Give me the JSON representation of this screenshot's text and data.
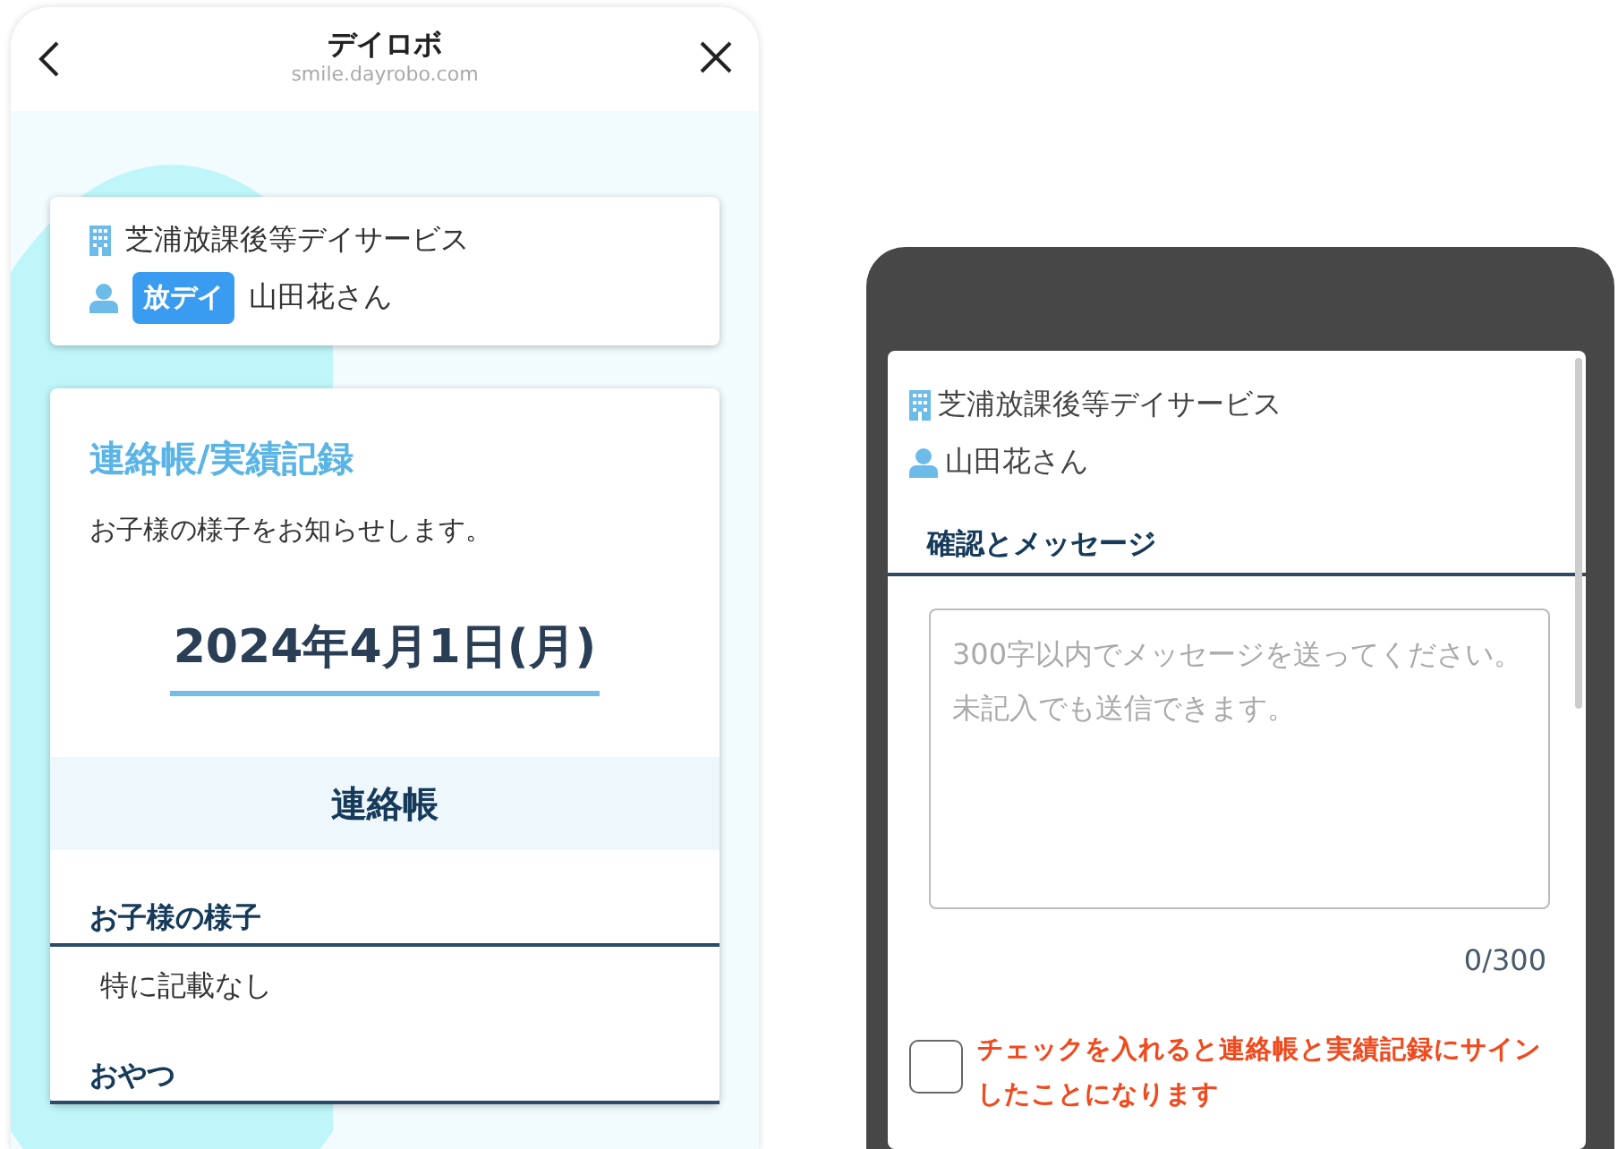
{
  "left_screen": {
    "header": {
      "title": "デイロボ",
      "url": "smile.dayrobo.com"
    },
    "facility_card": {
      "facility": "芝浦放課後等デイサービス",
      "service_tag": "放デイ",
      "child": "山田花さん"
    },
    "record": {
      "title": "連絡帳/実績記録",
      "intro": "お子様の様子をお知らせします。",
      "date": "2024年4月1日(月)",
      "section": "連絡帳",
      "fields": [
        {
          "label": "お子様の様子",
          "value": "特に記載なし"
        },
        {
          "label": "おやつ"
        }
      ]
    }
  },
  "right_screen": {
    "sheet": {
      "facility": "芝浦放課後等デイサービス",
      "child": "山田花さん",
      "heading": "確認とメッセージ",
      "message": {
        "placeholder": "300字以内でメッセージを送ってください。未記入でも送信できます。",
        "counter": "0/300"
      },
      "confirm": {
        "checked": false,
        "label": "チェックを入れると連絡帳と実績記録にサインしたことになります"
      }
    }
  }
}
